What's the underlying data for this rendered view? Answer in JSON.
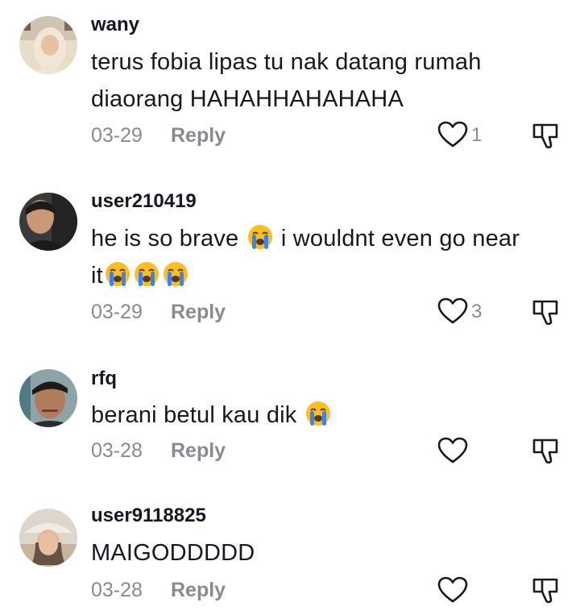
{
  "comments": [
    {
      "username": "wany",
      "text_line1": "terus fobia lipas tu nak datang rumah",
      "text_line2": "diaorang HAHAHHAHAHAHA",
      "date": "03-29",
      "reply_label": "Reply",
      "likes": "1"
    },
    {
      "username": "user210419",
      "text_a": "he is so brave",
      "text_b": "i wouldnt even go near",
      "text_c": "it",
      "emoji": "loudly-crying-face",
      "date": "03-29",
      "reply_label": "Reply",
      "likes": "3"
    },
    {
      "username": "rfq",
      "text_a": "berani betul kau dik",
      "emoji": "loudly-crying-face",
      "date": "03-28",
      "reply_label": "Reply",
      "likes": ""
    },
    {
      "username": "user9118825",
      "text_a": "MAIGODDDDD",
      "date": "03-28",
      "reply_label": "Reply",
      "likes": ""
    }
  ],
  "colors": {
    "text": "#161823",
    "secondary": "#8a8b91",
    "emoji_face": "#fbbf24",
    "emoji_tears": "#3b82f6"
  }
}
